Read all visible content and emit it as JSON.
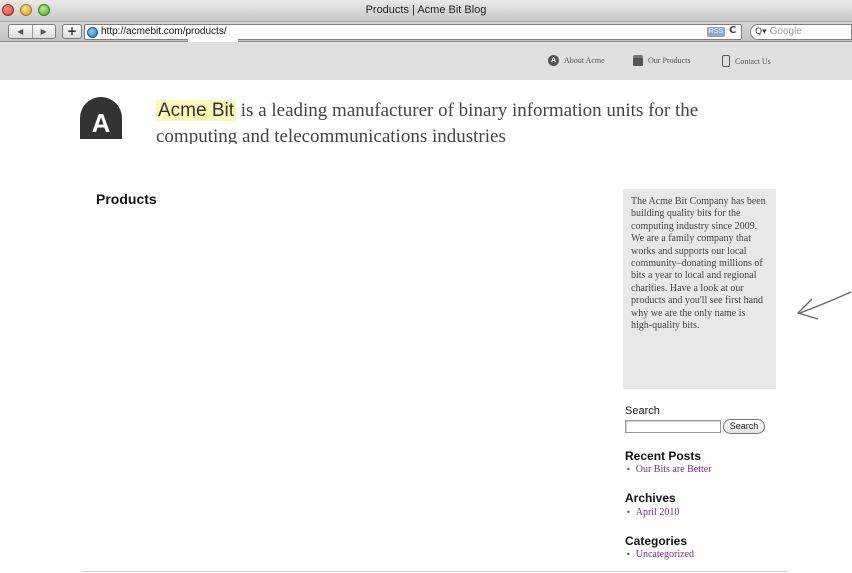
{
  "window": {
    "title": "Products | Acme Bit Blog"
  },
  "toolbar": {
    "back_icon": "◀",
    "forward_icon": "▶",
    "add_icon": "+",
    "url": "http://acmebit.com/products/",
    "rss_label": "RSS",
    "reload_icon": "C",
    "search_placeholder": "Google",
    "search_icon": "Q▾"
  },
  "site_nav": {
    "items": [
      {
        "label": "About Acme",
        "icon": "about-icon"
      },
      {
        "label": "Our Products",
        "icon": "products-icon"
      },
      {
        "label": "Contact Us",
        "icon": "contact-icon"
      }
    ]
  },
  "header": {
    "logo_letter": "A",
    "brand": "Acme Bit",
    "tagline_rest": " is a leading manufacturer of binary information units for the computing and telecommunications industries"
  },
  "main": {
    "page_title": "Products"
  },
  "sidebar": {
    "about_text": "The Acme Bit Company has been building quality bits for the computing industry since 2009. We are a family company that works and supports our local community–donating millions of bits a year to local and regional charities. Have a look at our products and you'll see first hand why we are the only name is high-quality bits.",
    "search": {
      "title": "Search",
      "input_value": "",
      "button_label": "Search"
    },
    "recent_posts": {
      "title": "Recent Posts",
      "items": [
        "Our Bits are Better"
      ]
    },
    "archives": {
      "title": "Archives",
      "items": [
        "April 2010"
      ]
    },
    "categories": {
      "title": "Categories",
      "items": [
        "Uncategorized"
      ]
    }
  },
  "colors": {
    "nav_bg": "#e0e0e0",
    "sidebar_box": "#e8e8e8",
    "brand_highlight": "#fdf8b8",
    "link": "#7a2a8a"
  }
}
